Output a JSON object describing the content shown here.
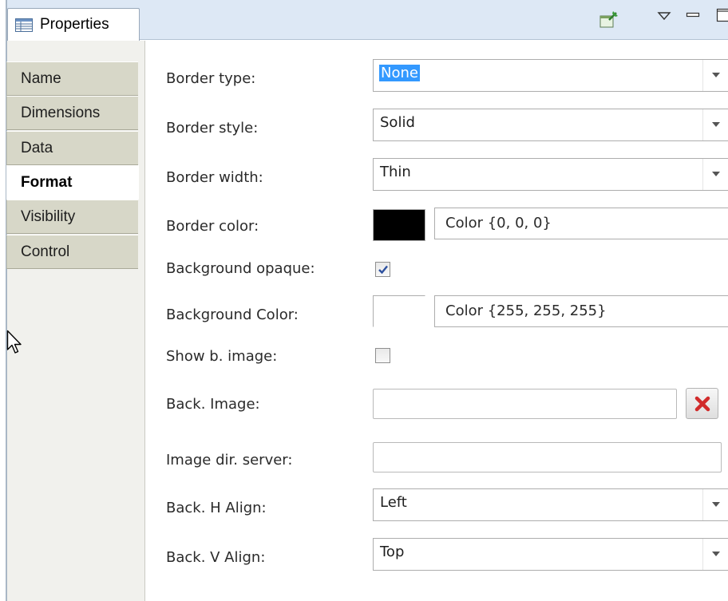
{
  "view": {
    "title": "Properties",
    "icon": "properties-table-icon",
    "toolbar_icons": [
      "pin-icon",
      "view-menu-icon",
      "minimize-icon",
      "maximize-icon"
    ]
  },
  "categories": [
    {
      "label": "Name",
      "active": false
    },
    {
      "label": "Dimensions",
      "active": false
    },
    {
      "label": "Data",
      "active": false
    },
    {
      "label": "Format",
      "active": true
    },
    {
      "label": "Visibility",
      "active": false
    },
    {
      "label": "Control",
      "active": false
    }
  ],
  "format": {
    "border_type": {
      "label": "Border type:",
      "value": "None"
    },
    "border_style": {
      "label": "Border style:",
      "value": "Solid"
    },
    "border_width": {
      "label": "Border width:",
      "value": "Thin"
    },
    "border_color": {
      "label": "Border color:",
      "value": "Color {0, 0, 0}",
      "swatch": "#000000"
    },
    "background_opaque": {
      "label": "Background opaque:",
      "checked": true
    },
    "background_color": {
      "label": "Background Color:",
      "value": "Color {255, 255, 255}",
      "swatch": "#ffffff"
    },
    "show_b_image": {
      "label": "Show b. image:",
      "checked": false
    },
    "back_image": {
      "label": "Back. Image:",
      "value": ""
    },
    "image_dir_server": {
      "label": "Image dir. server:",
      "value": ""
    },
    "back_h_align": {
      "label": "Back. H Align:",
      "value": "Left"
    },
    "back_v_align": {
      "label": "Back. V Align:",
      "value": "Top"
    }
  },
  "colors": {
    "accent_selection": "#3399ff",
    "tabstrip": "#dde8f5",
    "side_tab": "#d7d7c8",
    "delete_icon": "#d12b2b"
  }
}
